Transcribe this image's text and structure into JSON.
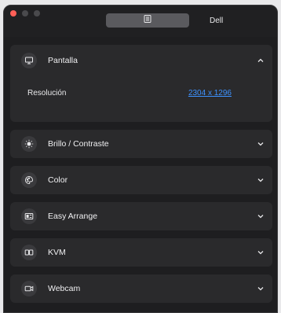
{
  "header": {
    "device_name": "Dell"
  },
  "sections": [
    {
      "id": "pantalla",
      "label": "Pantalla",
      "icon": "monitor-icon",
      "expanded": true
    },
    {
      "id": "brillo",
      "label": "Brillo / Contraste",
      "icon": "brightness-icon",
      "expanded": false
    },
    {
      "id": "color",
      "label": "Color",
      "icon": "palette-icon",
      "expanded": false
    },
    {
      "id": "easy-arrange",
      "label": "Easy Arrange",
      "icon": "layout-icon",
      "expanded": false
    },
    {
      "id": "kvm",
      "label": "KVM",
      "icon": "kvm-icon",
      "expanded": false
    },
    {
      "id": "webcam",
      "label": "Webcam",
      "icon": "webcam-icon",
      "expanded": false
    }
  ],
  "pantalla": {
    "resolution_label": "Resolución",
    "resolution_value": "2304 x 1296"
  },
  "colors": {
    "accent_link": "#3d92ff",
    "close_dot": "#ff5f57",
    "card_bg": "#2a2a2c",
    "window_bg": "#1e1e20"
  }
}
